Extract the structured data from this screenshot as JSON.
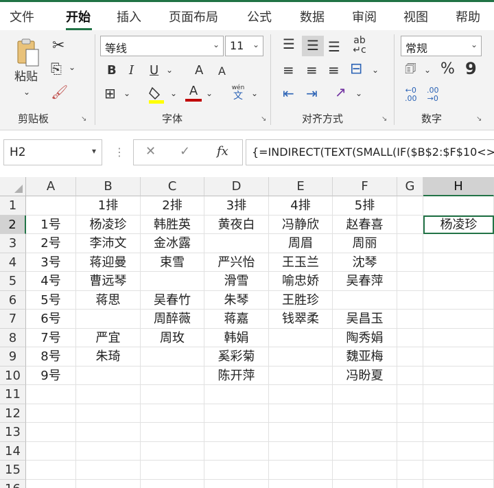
{
  "tabs": [
    "文件",
    "开始",
    "插入",
    "页面布局",
    "公式",
    "数据",
    "审阅",
    "视图",
    "帮助"
  ],
  "active_tab": "开始",
  "ribbon": {
    "clipboard": {
      "paste_label": "粘贴",
      "group_label": "剪贴板"
    },
    "font": {
      "font_name": "等线",
      "font_size": "11",
      "group_label": "字体",
      "bold": "B",
      "italic": "I",
      "underline": "U",
      "grow": "A",
      "shrink": "A",
      "wen": "wén"
    },
    "alignment": {
      "group_label": "对齐方式"
    },
    "number": {
      "format": "常规",
      "percent": "%",
      "comma": "9",
      "group_label": "数字"
    }
  },
  "formula_bar": {
    "name_box": "H2",
    "formula": "{=INDIRECT(TEXT(SMALL(IF($B$2:$F$10<>",
    "fx_label": "fx"
  },
  "sheet": {
    "columns": [
      "A",
      "B",
      "C",
      "D",
      "E",
      "F",
      "G",
      "H"
    ],
    "selected_column": "H",
    "selected_row": "2",
    "rows": [
      {
        "n": "1",
        "cells": [
          "",
          "1排",
          "2排",
          "3排",
          "4排",
          "5排",
          "",
          ""
        ]
      },
      {
        "n": "2",
        "cells": [
          "1号",
          "杨凌珍",
          "韩胜英",
          "黄夜白",
          "冯静欣",
          "赵春喜",
          "",
          "杨凌珍"
        ]
      },
      {
        "n": "3",
        "cells": [
          "2号",
          "李沛文",
          "金冰露",
          "",
          "周眉",
          "周丽",
          "",
          ""
        ]
      },
      {
        "n": "4",
        "cells": [
          "3号",
          "蒋迎曼",
          "束雪",
          "严兴怡",
          "王玉兰",
          "沈琴",
          "",
          ""
        ]
      },
      {
        "n": "5",
        "cells": [
          "4号",
          "曹远琴",
          "",
          "滑雪",
          "喻忠娇",
          "吴春萍",
          "",
          ""
        ]
      },
      {
        "n": "6",
        "cells": [
          "5号",
          "蒋思",
          "吴春竹",
          "朱琴",
          "王胜珍",
          "",
          "",
          ""
        ]
      },
      {
        "n": "7",
        "cells": [
          "6号",
          "",
          "周醉薇",
          "蒋嘉",
          "钱翠柔",
          "吴昌玉",
          "",
          ""
        ]
      },
      {
        "n": "8",
        "cells": [
          "7号",
          "严宜",
          "周玫",
          "韩娟",
          "",
          "陶秀娟",
          "",
          ""
        ]
      },
      {
        "n": "9",
        "cells": [
          "8号",
          "朱琦",
          "",
          "奚彩菊",
          "",
          "魏亚梅",
          "",
          ""
        ]
      },
      {
        "n": "10",
        "cells": [
          "9号",
          "",
          "",
          "陈开萍",
          "",
          "冯盼夏",
          "",
          ""
        ]
      },
      {
        "n": "11",
        "cells": [
          "",
          "",
          "",
          "",
          "",
          "",
          "",
          ""
        ]
      },
      {
        "n": "12",
        "cells": [
          "",
          "",
          "",
          "",
          "",
          "",
          "",
          ""
        ]
      },
      {
        "n": "13",
        "cells": [
          "",
          "",
          "",
          "",
          "",
          "",
          "",
          ""
        ]
      },
      {
        "n": "14",
        "cells": [
          "",
          "",
          "",
          "",
          "",
          "",
          "",
          ""
        ]
      },
      {
        "n": "15",
        "cells": [
          "",
          "",
          "",
          "",
          "",
          "",
          "",
          ""
        ]
      },
      {
        "n": "16",
        "cells": [
          "",
          "",
          "",
          "",
          "",
          "",
          "",
          ""
        ]
      }
    ]
  },
  "colors": {
    "accent": "#217346"
  }
}
